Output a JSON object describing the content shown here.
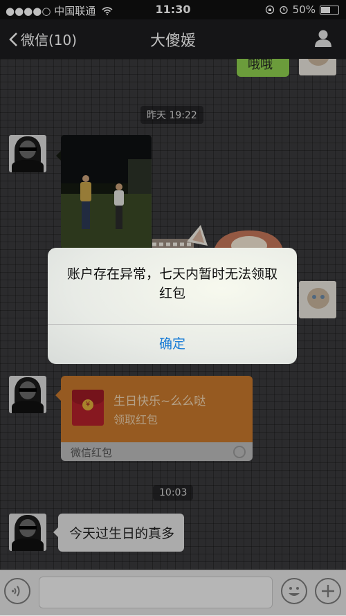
{
  "status_bar": {
    "signal": "●●●●○",
    "carrier": "中国联通",
    "wifi_icon": "wifi-icon",
    "time": "11:30",
    "battery": "50%",
    "battery_level": 0.5
  },
  "nav": {
    "back_label": "微信(10)",
    "title": "大傻媛"
  },
  "chat": {
    "partial_message": "哦哦",
    "timestamps": [
      "昨天 19:22",
      "10:03"
    ],
    "red_packet": {
      "greeting": "生日快乐~么么哒",
      "action": "领取红包",
      "footer": "微信红包"
    },
    "last_message": "今天过生日的真多"
  },
  "dialog": {
    "message": "账户存在异常，七天内暂时无法领取红包",
    "confirm": "确定"
  },
  "colors": {
    "sent_bubble": "#8fd14f",
    "red_packet": "#c9792c",
    "dialog_button": "#1479d6"
  }
}
